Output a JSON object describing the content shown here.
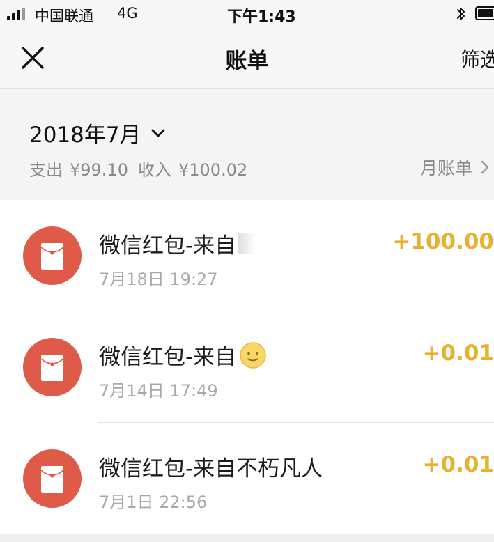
{
  "status_bar": {
    "carrier": "中国联通",
    "network": "4G",
    "time": "下午1:43"
  },
  "nav": {
    "title": "账单",
    "filter_label": "筛选"
  },
  "summary": {
    "month": "2018年7月",
    "expense_label": "支出",
    "expense_amount": "¥99.10",
    "income_label": "收入",
    "income_amount": "¥100.02",
    "monthly_bill_label": "月账单"
  },
  "bills": [
    {
      "title": "微信红包-来自",
      "time": "7月18日 19:27",
      "amount": "+100.00"
    },
    {
      "title": "微信红包-来自",
      "time": "7月14日 17:49",
      "amount": "+0.01"
    },
    {
      "title": "微信红包-来自不朽凡人",
      "time": "7月1日 22:56",
      "amount": "+0.01"
    }
  ],
  "colors": {
    "accent_amount": "#e9b130",
    "redpacket": "#e05a4a"
  },
  "icons": {
    "close": "close-icon",
    "chevron": "chevron-down-icon",
    "redpacket": "red-packet-icon",
    "emoji": "smiley-emoji-icon"
  }
}
